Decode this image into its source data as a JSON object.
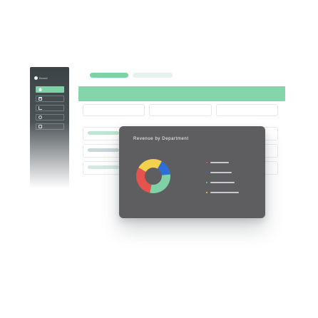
{
  "app": {
    "brand_name": "Brand",
    "sidebar": {
      "items": [
        {
          "icon": "home-icon",
          "active": true
        },
        {
          "icon": "folder-icon",
          "active": false
        },
        {
          "icon": "chart-icon",
          "active": false
        },
        {
          "icon": "gear-icon",
          "active": false
        },
        {
          "icon": "message-icon",
          "active": false
        }
      ]
    },
    "colors": {
      "accent": "#7fd1a6",
      "sidebar_bg": "#3c4346",
      "modal_bg": "#5e5e60"
    }
  },
  "modal": {
    "title": "Revenue by Department"
  },
  "chart_data": {
    "type": "pie",
    "title": "Revenue by Department",
    "donut": true,
    "values": [
      25,
      15,
      30,
      30
    ],
    "colors": [
      "#f2d14e",
      "#2d6fd6",
      "#7fd1a6",
      "#e4534d"
    ],
    "legend_colors": [
      "#e4534d",
      "#2d6fd6",
      "#7fd1a6",
      "#f2d14e"
    ]
  }
}
